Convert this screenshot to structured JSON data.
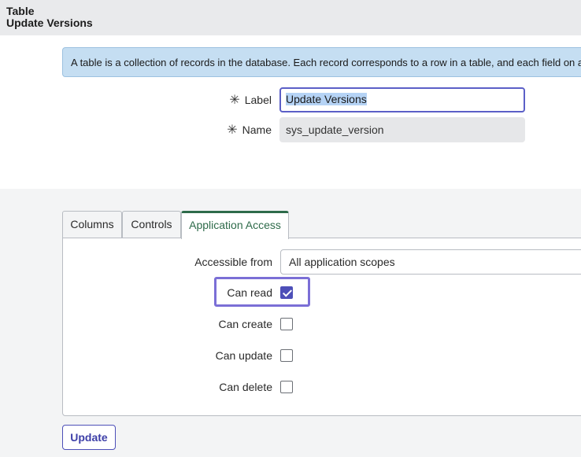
{
  "header": {
    "type_label": "Table",
    "record_title": "Update Versions"
  },
  "info_banner": {
    "text": "A table is a collection of records in the database. Each record corresponds to a row in a table, and each field on a record corresponds to a column"
  },
  "form": {
    "label_field": {
      "label": "Label",
      "value": "Update Versions",
      "required_mark": "✳"
    },
    "name_field": {
      "label": "Name",
      "value": "sys_update_version",
      "required_mark": "✳"
    }
  },
  "tabs": [
    {
      "label": "Columns",
      "active": false
    },
    {
      "label": "Controls",
      "active": false
    },
    {
      "label": "Application Access",
      "active": true
    }
  ],
  "application_access": {
    "accessible_from": {
      "label": "Accessible from",
      "value": "All application scopes"
    },
    "can_read": {
      "label": "Can read",
      "checked": true
    },
    "can_create": {
      "label": "Can create",
      "checked": false
    },
    "can_update": {
      "label": "Can update",
      "checked": false
    },
    "can_delete": {
      "label": "Can delete",
      "checked": false
    }
  },
  "actions": {
    "update_label": "Update"
  },
  "colors": {
    "accent": "#4d4fb8",
    "active_tab": "#2e6b4a",
    "banner_bg": "#c5def2",
    "header_bg": "#e9eaec"
  }
}
